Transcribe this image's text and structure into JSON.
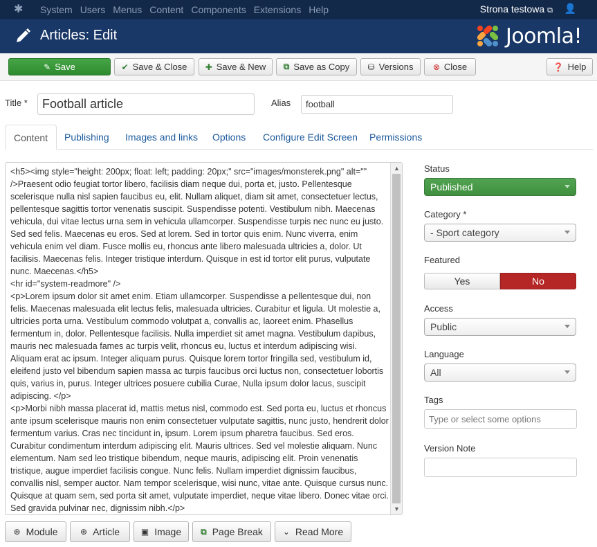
{
  "topnav": {
    "menu": [
      "System",
      "Users",
      "Menus",
      "Content",
      "Components",
      "Extensions",
      "Help"
    ],
    "site_name": "Strona testowa"
  },
  "header": {
    "title": "Articles: Edit",
    "brand": "Joomla!"
  },
  "toolbar": {
    "save": "Save",
    "save_close": "Save & Close",
    "save_new": "Save & New",
    "save_copy": "Save as Copy",
    "versions": "Versions",
    "close": "Close",
    "help": "Help"
  },
  "form": {
    "title_label": "Title *",
    "title_value": "Football article",
    "alias_label": "Alias",
    "alias_value": "football"
  },
  "tabs": [
    "Content",
    "Publishing",
    "Images and links",
    "Options",
    "Configure Edit Screen",
    "Permissions"
  ],
  "editor": {
    "content": "<h5><img style=\"height: 200px; float: left; padding: 20px;\" src=\"images/monsterek.png\" alt=\"\" />Praesent odio feugiat tortor libero, facilisis diam neque dui, porta et, justo. Pellentesque scelerisque nulla nisl sapien faucibus eu, elit. Nullam aliquet, diam sit amet, consectetuer lectus, pellentesque sagittis tortor venenatis suscipit. Suspendisse potenti. Vestibulum nibh. Maecenas vehicula, dui vitae lectus urna sem in vehicula ullamcorper. Suspendisse turpis nec nunc eu justo. Sed sed felis. Maecenas eu eros. Sed at lorem. Sed in tortor quis enim. Nunc viverra, enim vehicula enim vel diam. Fusce mollis eu, rhoncus ante libero malesuada ultricies a, dolor. Ut facilisis. Maecenas felis. Integer tristique interdum. Quisque in est id tortor elit purus, vulputate nunc. Maecenas.</h5>\n<hr id=\"system-readmore\" />\n<p>Lorem ipsum dolor sit amet enim. Etiam ullamcorper. Suspendisse a pellentesque dui, non felis. Maecenas malesuada elit lectus felis, malesuada ultricies. Curabitur et ligula. Ut molestie a, ultricies porta urna. Vestibulum commodo volutpat a, convallis ac, laoreet enim. Phasellus fermentum in, dolor. Pellentesque facilisis. Nulla imperdiet sit amet magna. Vestibulum dapibus, mauris nec malesuada fames ac turpis velit, rhoncus eu, luctus et interdum adipiscing wisi. Aliquam erat ac ipsum. Integer aliquam purus. Quisque lorem tortor fringilla sed, vestibulum id, eleifend justo vel bibendum sapien massa ac turpis faucibus orci luctus non, consectetuer lobortis quis, varius in, purus. Integer ultrices posuere cubilia Curae, Nulla ipsum dolor lacus, suscipit adipiscing. </p>\n<p>Morbi nibh massa placerat id, mattis metus nisl, commodo est. Sed porta eu, luctus et rhoncus ante ipsum scelerisque mauris non enim consectetuer vulputate sagittis, nunc justo, hendrerit dolor fermentum varius. Cras nec tincidunt in, ipsum. Lorem ipsum pharetra faucibus. Sed eros. Curabitur condimentum interdum adipiscing elit. Mauris ultrices. Sed vel molestie aliquam. Nunc elementum. Nam sed leo tristique bibendum, neque mauris, adipiscing elit. Proin venenatis tristique, augue imperdiet facilisis congue. Nunc felis. Nullam imperdiet dignissim faucibus, convallis nisl, semper auctor. Nam tempor scelerisque, wisi nunc, vitae ante. Quisque cursus nunc. Quisque at quam sem, sed porta sit amet, vulputate imperdiet, neque vitae libero. Donec vitae orci. Sed gravida pulvinar nec, dignissim nibh.</p>"
  },
  "editor_buttons": {
    "module": "Module",
    "article": "Article",
    "image": "Image",
    "page_break": "Page Break",
    "read_more": "Read More"
  },
  "sidebar": {
    "status_label": "Status",
    "status_value": "Published",
    "category_label": "Category *",
    "category_value": "- Sport category",
    "featured_label": "Featured",
    "featured_yes": "Yes",
    "featured_no": "No",
    "featured_selected": "No",
    "access_label": "Access",
    "access_value": "Public",
    "language_label": "Language",
    "language_value": "All",
    "tags_label": "Tags",
    "tags_placeholder": "Type or select some options",
    "version_note_label": "Version Note",
    "version_note_value": ""
  },
  "colors": {
    "topnav_bg": "#13294a",
    "header_bg": "#1a3867",
    "save_green": "#3f963f",
    "featured_no_red": "#b52626",
    "link_blue": "#1c5a9c"
  }
}
